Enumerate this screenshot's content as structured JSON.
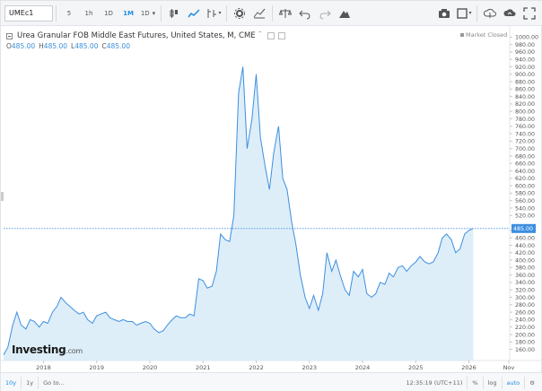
{
  "toolbar": {
    "symbol": "UMEc1",
    "intervals": [
      "5",
      "1h",
      "1D",
      "1M",
      "1D"
    ],
    "active_interval_index": 3,
    "icons": [
      "chart-type-icon",
      "line-icon",
      "indicator-icon",
      "settings-icon",
      "compare-icon",
      "templates-icon",
      "undo-icon",
      "redo-icon",
      "alert-icon",
      "camera-icon",
      "fullscreen-box-icon",
      "cloud-download-icon",
      "cloud-upload-icon",
      "fullscreen-icon"
    ]
  },
  "header": {
    "title": "Urea Granular FOB Middle East Futures, United States, M, CME",
    "ohlc": {
      "o_label": "O",
      "o": "485.00",
      "h_label": "H",
      "h": "485.00",
      "l_label": "L",
      "l": "485.00",
      "c_label": "C",
      "c": "485.00"
    },
    "status": "Market Closed"
  },
  "logo": {
    "name": "Investing",
    "suffix": ".com"
  },
  "bottombar": {
    "ranges": [
      "10y",
      "1y",
      "Go to..."
    ],
    "active_range_index": 0,
    "timestamp": "12:35:19 (UTC+11)",
    "percent": "%",
    "log": "log",
    "auto": "auto"
  },
  "colors": {
    "line": "#3d8fe0",
    "fill": "#d7ebf8",
    "accent": "#1c8ee6",
    "last_price_bg": "#3d8fe0"
  },
  "chart_data": {
    "type": "area",
    "title": "Urea Granular FOB Middle East Futures, United States, M, CME",
    "last_price": 485.0,
    "last_price_label": "485.00",
    "ylim": [
      130,
      1020
    ],
    "yticks": [
      160,
      180,
      200,
      220,
      240,
      260,
      280,
      300,
      320,
      340,
      360,
      380,
      400,
      420,
      440,
      460,
      480,
      520,
      540,
      560,
      580,
      600,
      620,
      640,
      660,
      680,
      700,
      720,
      740,
      760,
      780,
      800,
      820,
      840,
      860,
      880,
      900,
      920,
      940,
      960,
      980,
      1000
    ],
    "ytick_labels": [
      "160.00",
      "180.00",
      "200.00",
      "220.00",
      "240.00",
      "260.00",
      "280.00",
      "300.00",
      "320.00",
      "340.00",
      "360.00",
      "380.00",
      "400.00",
      "420.00",
      "440.00",
      "460.00",
      "480.00",
      "520.00",
      "540.00",
      "560.00",
      "580.00",
      "600.00",
      "620.00",
      "640.00",
      "660.00",
      "680.00",
      "700.00",
      "720.00",
      "740.00",
      "760.00",
      "780.00",
      "800.00",
      "820.00",
      "840.00",
      "860.00",
      "880.00",
      "900.00",
      "920.00",
      "940.00",
      "960.00",
      "980.00",
      "1000.00"
    ],
    "x_start": 2017.25,
    "x_end": 2026.75,
    "xticks": [
      2018,
      2019,
      2020,
      2021,
      2022,
      2023,
      2024,
      2025,
      2026
    ],
    "xtick_labels": [
      "2018",
      "2019",
      "2020",
      "2021",
      "2022",
      "2023",
      "2024",
      "2025",
      "2026",
      "Nov"
    ],
    "nov_tick": 2026.75,
    "x": [
      2017.25,
      2017.33,
      2017.42,
      2017.5,
      2017.58,
      2017.67,
      2017.75,
      2017.83,
      2017.92,
      2018.0,
      2018.08,
      2018.17,
      2018.25,
      2018.33,
      2018.42,
      2018.5,
      2018.58,
      2018.67,
      2018.75,
      2018.83,
      2018.92,
      2019.0,
      2019.08,
      2019.17,
      2019.25,
      2019.33,
      2019.42,
      2019.5,
      2019.58,
      2019.67,
      2019.75,
      2019.83,
      2019.92,
      2020.0,
      2020.08,
      2020.17,
      2020.25,
      2020.33,
      2020.42,
      2020.5,
      2020.58,
      2020.67,
      2020.75,
      2020.83,
      2020.92,
      2021.0,
      2021.08,
      2021.17,
      2021.25,
      2021.33,
      2021.42,
      2021.5,
      2021.58,
      2021.67,
      2021.75,
      2021.83,
      2021.92,
      2022.0,
      2022.08,
      2022.17,
      2022.25,
      2022.33,
      2022.42,
      2022.5,
      2022.58,
      2022.67,
      2022.75,
      2022.83,
      2022.92,
      2023.0,
      2023.08,
      2023.17,
      2023.25,
      2023.33,
      2023.42,
      2023.5,
      2023.58,
      2023.67,
      2023.75,
      2023.83,
      2023.92,
      2024.0,
      2024.08,
      2024.17,
      2024.25,
      2024.33,
      2024.42,
      2024.5,
      2024.58,
      2024.67,
      2024.75,
      2024.83,
      2024.92,
      2025.0,
      2025.08,
      2025.17,
      2025.25,
      2025.33,
      2025.42,
      2025.5,
      2025.58,
      2025.67,
      2025.75,
      2025.83,
      2025.92,
      2026.0,
      2026.08
    ],
    "y": [
      145,
      165,
      225,
      260,
      225,
      215,
      240,
      235,
      220,
      235,
      230,
      260,
      275,
      300,
      285,
      275,
      265,
      255,
      260,
      240,
      230,
      250,
      255,
      260,
      245,
      240,
      235,
      240,
      235,
      235,
      225,
      230,
      235,
      230,
      215,
      205,
      210,
      225,
      240,
      250,
      245,
      245,
      255,
      250,
      350,
      345,
      325,
      330,
      370,
      470,
      455,
      450,
      520,
      850,
      920,
      700,
      780,
      900,
      730,
      650,
      590,
      690,
      760,
      620,
      590,
      500,
      440,
      360,
      300,
      270,
      305,
      265,
      310,
      420,
      370,
      400,
      360,
      320,
      305,
      370,
      355,
      375,
      310,
      300,
      310,
      340,
      335,
      365,
      355,
      380,
      385,
      370,
      385,
      395,
      410,
      395,
      390,
      395,
      420,
      460,
      470,
      455,
      420,
      430,
      470,
      480,
      485
    ]
  }
}
